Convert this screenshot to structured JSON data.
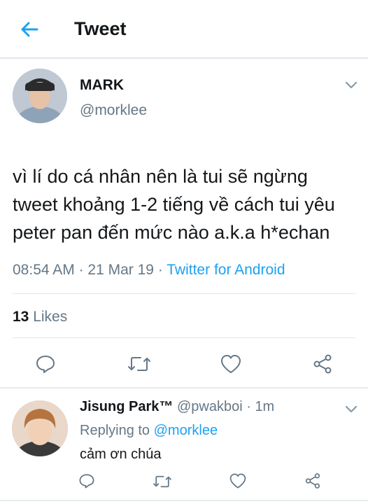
{
  "header": {
    "title": "Tweet"
  },
  "tweet": {
    "display_name": "MARK",
    "handle": "@morklee",
    "text": "vì lí do cá nhân nên là tui sẽ ngừng tweet khoảng 1-2 tiếng về cách tui yêu peter pan đến mức nào a.k.a h*echan",
    "time": "08:54 AM",
    "date": "21 Mar 19",
    "source": "Twitter for Android",
    "likes_count": "13",
    "likes_label": "Likes"
  },
  "reply": {
    "display_name": "Jisung Park™",
    "handle": "@pwakboi",
    "age": "1m",
    "replying_prefix": "Replying to",
    "replying_to": "@morklee",
    "text": "cảm ơn chúa"
  },
  "colors": {
    "link": "#1da1f2",
    "secondary": "#657786",
    "icon": "#657786",
    "divider": "#e1e8ed"
  },
  "icons": [
    "back-arrow-icon",
    "chevron-down-icon",
    "reply-icon",
    "retweet-icon",
    "like-icon",
    "share-icon"
  ]
}
